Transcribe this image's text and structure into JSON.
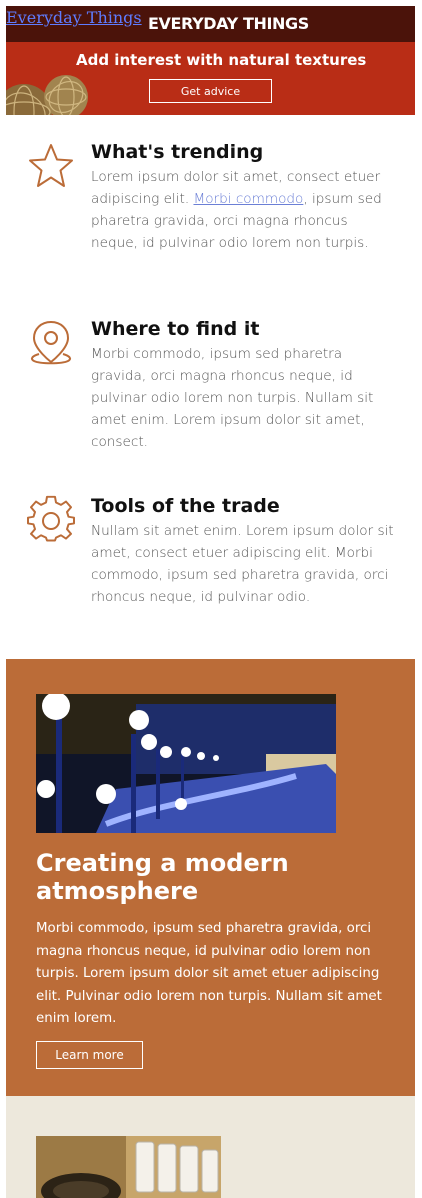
{
  "header": {
    "brand_link": "Everyday Things",
    "brand_title": "EVERYDAY THINGS",
    "tagline": "Add interest with natural textures",
    "cta_label": "Get advice"
  },
  "features": [
    {
      "title": "What's trending",
      "icon": "star-icon",
      "text_before": "Lorem ipsum dolor sit amet, consect etuer adipiscing elit. ",
      "link_text": "Morbi commodo",
      "text_after": ", ipsum sed pharetra gravida, orci magna rhoncus neque, id pulvinar odio lorem non turpis."
    },
    {
      "title": "Where to find it",
      "icon": "map-pin-icon",
      "text": "Morbi commodo, ipsum sed pharetra gravida, orci magna rhoncus neque, id pulvinar odio lorem non turpis. Nullam sit amet enim. Lorem ipsum dolor sit amet, consect."
    },
    {
      "title": "Tools of the trade",
      "icon": "gear-icon",
      "text": "Nullam sit amet enim. Lorem ipsum dolor sit amet, consect etuer adipiscing elit. Morbi commodo, ipsum sed pharetra gravida, orci rhoncus neque, id pulvinar odio."
    }
  ],
  "modern": {
    "title": "Creating a modern atmosphere",
    "text": "Morbi commodo, ipsum sed pharetra gravida, orci magna rhoncus neque, id pulvinar odio lorem non turpis. Lorem ipsum dolor sit amet etuer adipiscing elit. Pulvinar odio lorem non turpis. Nullam sit amet enim lorem.",
    "button_label": "Learn more"
  },
  "colors": {
    "header_dark": "#4b130a",
    "header_red": "#b92d16",
    "icon_brown": "#bb6c38",
    "modern_bg": "#bb6c38",
    "beige_bg": "#ede8dc"
  }
}
